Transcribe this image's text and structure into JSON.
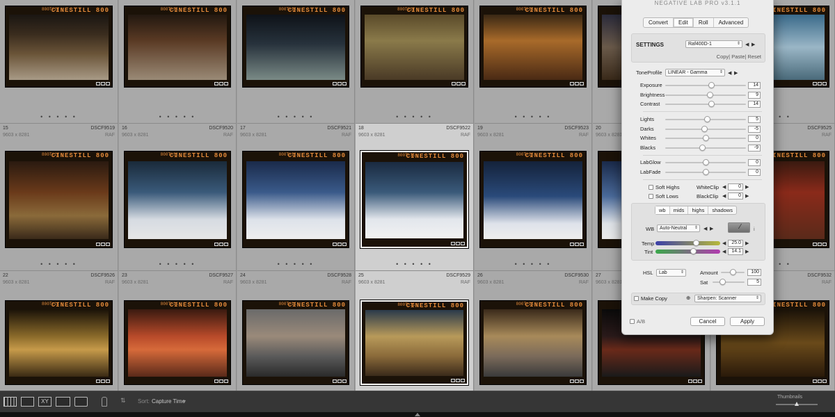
{
  "grid": {
    "film_stock_text": "CINESTILL 800",
    "film_edge_small": "800T-11",
    "rows": [
      {
        "cells": [
          {
            "index": "",
            "file": "",
            "dimensions": "",
            "ext": ""
          },
          {
            "index": "",
            "file": "",
            "dimensions": "",
            "ext": ""
          },
          {
            "index": "",
            "file": "",
            "dimensions": "",
            "ext": ""
          },
          {
            "index": "",
            "file": "",
            "dimensions": "",
            "ext": ""
          },
          {
            "index": "",
            "file": "",
            "dimensions": "",
            "ext": ""
          },
          {
            "index": "",
            "file": "",
            "dimensions": "",
            "ext": ""
          },
          {
            "index": "",
            "file": "",
            "dimensions": "",
            "ext": ""
          }
        ]
      },
      {
        "cells": [
          {
            "index": "15",
            "file": "DSCF9519",
            "dimensions": "9603 x 8281",
            "ext": "RAF"
          },
          {
            "index": "16",
            "file": "DSCF9520",
            "dimensions": "9603 x 8281",
            "ext": "RAF"
          },
          {
            "index": "17",
            "file": "DSCF9521",
            "dimensions": "9603 x 8281",
            "ext": "RAF"
          },
          {
            "index": "18",
            "file": "DSCF9522",
            "dimensions": "9603 x 8281",
            "ext": "RAF"
          },
          {
            "index": "19",
            "file": "DSCF9523",
            "dimensions": "9603 x 8281",
            "ext": "RAF"
          },
          {
            "index": "20",
            "file": "",
            "dimensions": "9603 x 8281",
            "ext": ""
          },
          {
            "index": "",
            "file": "DSCF9525",
            "dimensions": "",
            "ext": "RAF"
          }
        ]
      },
      {
        "cells": [
          {
            "index": "22",
            "file": "DSCF9526",
            "dimensions": "9603 x 8281",
            "ext": "RAF"
          },
          {
            "index": "23",
            "file": "DSCF9527",
            "dimensions": "9603 x 8281",
            "ext": "RAF"
          },
          {
            "index": "24",
            "file": "DSCF9528",
            "dimensions": "9603 x 8281",
            "ext": "RAF"
          },
          {
            "index": "25",
            "file": "DSCF9529",
            "dimensions": "9603 x 8281",
            "ext": "RAF"
          },
          {
            "index": "26",
            "file": "DSCF9530",
            "dimensions": "9603 x 8281",
            "ext": "RAF"
          },
          {
            "index": "27",
            "file": "",
            "dimensions": "9603 x 8281",
            "ext": ""
          },
          {
            "index": "",
            "file": "DSCF9532",
            "dimensions": "",
            "ext": "RAF"
          }
        ]
      }
    ]
  },
  "toolbar": {
    "sort_label": "Sort:",
    "sort_value": "Capture Time",
    "thumbnails_label": "Thumbnails",
    "thumbnail_size": 0.5
  },
  "panel": {
    "title": "NEGATIVE LAB PRO v3.1.1",
    "tabs": [
      "Convert",
      "Edit",
      "Roll",
      "Advanced"
    ],
    "active_tab": "Edit",
    "settings_label": "SETTINGS",
    "settings_value": "Raf400D-1",
    "copy_links": "Copy| Paste| Reset",
    "tone_profile_label": "ToneProfile",
    "tone_profile_value": "LINEAR - Gamma",
    "sliders_a": [
      {
        "label": "Exposure",
        "value": "14",
        "level": 0.57
      },
      {
        "label": "Brightness",
        "value": "9",
        "level": 0.55
      },
      {
        "label": "Contrast",
        "value": "14",
        "level": 0.57
      }
    ],
    "sliders_b": [
      {
        "label": "Lights",
        "value": "5",
        "level": 0.52
      },
      {
        "label": "Darks",
        "value": "-5",
        "level": 0.48
      },
      {
        "label": "Whites",
        "value": "0",
        "level": 0.5
      },
      {
        "label": "Blacks",
        "value": "-9",
        "level": 0.46
      }
    ],
    "sliders_c": [
      {
        "label": "LabGlow",
        "value": "0",
        "level": 0.5
      },
      {
        "label": "LabFade",
        "value": "0",
        "level": 0.5
      }
    ],
    "soft_highs": "Soft Highs",
    "soft_lows": "Soft Lows",
    "whiteclip_label": "WhiteClip",
    "whiteclip_value": "0",
    "blackclip_label": "BlackClip",
    "blackclip_value": "0",
    "subtabs": [
      "wb",
      "mids",
      "highs",
      "shadows"
    ],
    "active_subtab": "wb",
    "wb_label": "WB",
    "wb_value": "Auto-Neutral",
    "temp_label": "Temp",
    "temp_value": "25.0",
    "temp_level": 0.62,
    "tint_label": "Tint",
    "tint_value": "14.1",
    "tint_level": 0.58,
    "hsl_label": "HSL",
    "hsl_value": "Lab",
    "amount_label": "Amount",
    "amount_value": "100",
    "amount_level": 0.5,
    "sat_label": "Sat",
    "sat_value": "5",
    "sat_level": 0.3,
    "make_copy": "Make Copy",
    "sharpen_value": "Sharpen: Scanner",
    "ab_label": "A/B",
    "cancel_label": "Cancel",
    "apply_label": "Apply"
  },
  "colors": {
    "film_orange": "#e48a3a",
    "panel_bg": "#ececec",
    "temp_gradient": [
      "#3b3fa8",
      "#b7b93a"
    ],
    "tint_gradient": [
      "#3aa84a",
      "#b23ab0"
    ]
  }
}
